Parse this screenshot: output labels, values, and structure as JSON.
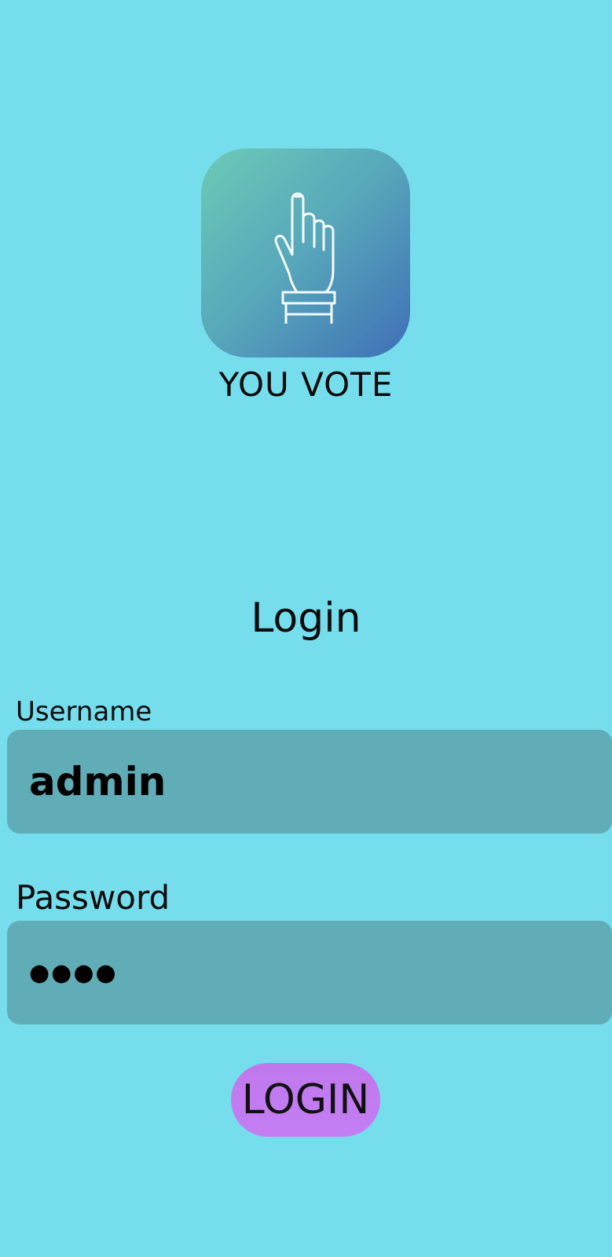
{
  "app": {
    "name": "YOU VOTE",
    "logo_icon": "voting-hand-icon"
  },
  "login": {
    "heading": "Login",
    "username_label": "Username",
    "username_value": "admin",
    "password_label": "Password",
    "password_value": "●●●●",
    "button_label": "LOGIN"
  },
  "colors": {
    "background": "#76dded",
    "input_fill": "#60adb7",
    "button": "#c47ef4"
  }
}
